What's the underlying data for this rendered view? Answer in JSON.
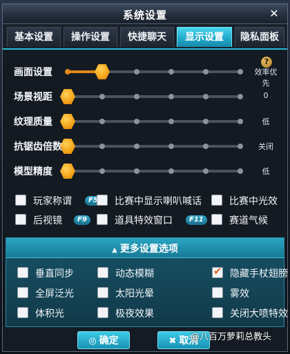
{
  "window": {
    "title": "系统设置",
    "close_glyph": "✕"
  },
  "tabs": [
    {
      "label": "基本设置",
      "active": false
    },
    {
      "label": "操作设置",
      "active": false
    },
    {
      "label": "快捷聊天",
      "active": false
    },
    {
      "label": "显示设置",
      "active": true
    },
    {
      "label": "隐私面板",
      "active": false
    }
  ],
  "help": {
    "glyph": "?"
  },
  "sliders": [
    {
      "label": "画面设置",
      "value_text": "效率优先",
      "level": 0.2,
      "steps": 6
    },
    {
      "label": "场景视距",
      "value_text": "0",
      "level": 0.0,
      "steps": 6
    },
    {
      "label": "纹理质量",
      "value_text": "低",
      "level": 0.0,
      "steps": 6
    },
    {
      "label": "抗锯齿倍数",
      "value_text": "关闭",
      "level": 0.0,
      "steps": 6
    },
    {
      "label": "模型精度",
      "value_text": "低",
      "level": 0.0,
      "steps": 6
    }
  ],
  "options": [
    {
      "label": "玩家称谓",
      "checked": false,
      "key": "F5"
    },
    {
      "label": "比赛中显示喇叭喊话",
      "checked": false,
      "key": ""
    },
    {
      "label": "比赛中光效",
      "checked": false,
      "key": ""
    },
    {
      "label": "后视镜",
      "checked": false,
      "key": "F9"
    },
    {
      "label": "道具特效窗口",
      "checked": false,
      "key": "F11"
    },
    {
      "label": "赛道气候",
      "checked": false,
      "key": ""
    }
  ],
  "more": {
    "label": "更多设置选项",
    "items": [
      {
        "label": "垂直同步",
        "checked": false
      },
      {
        "label": "动态模糊",
        "checked": false
      },
      {
        "label": "隐藏手杖翅膀",
        "checked": true
      },
      {
        "label": "全屏泛光",
        "checked": false
      },
      {
        "label": "太阳光晕",
        "checked": false
      },
      {
        "label": "雾效",
        "checked": false
      },
      {
        "label": "体积光",
        "checked": false
      },
      {
        "label": "极夜效果",
        "checked": false
      },
      {
        "label": "关闭大喷特效",
        "checked": false
      }
    ]
  },
  "buttons": {
    "ok": "确定",
    "cancel": "取消",
    "ok_icon": "◎",
    "cancel_icon": "✖"
  },
  "watermark": "@八百万萝莉总教头",
  "colors": {
    "accent": "#27bcd8",
    "thumb": "#f5a51a",
    "fill": "#e2881a",
    "check": "#e4661d"
  }
}
